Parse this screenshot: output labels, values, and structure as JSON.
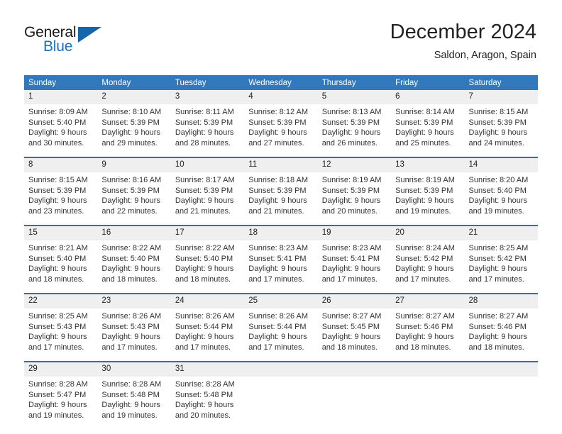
{
  "brand": {
    "name_part1": "General",
    "name_part2": "Blue",
    "triangle_icon": "triangle-icon",
    "accent_color": "#1565ad"
  },
  "header": {
    "month_title": "December 2024",
    "location": "Saldon, Aragon, Spain"
  },
  "calendar": {
    "header_color": "#3178bd",
    "daynum_background": "#efefef",
    "week_separator_color": "#2f6fab",
    "weekdays": [
      "Sunday",
      "Monday",
      "Tuesday",
      "Wednesday",
      "Thursday",
      "Friday",
      "Saturday"
    ],
    "weeks": [
      [
        {
          "day": "1",
          "sunrise": "Sunrise: 8:09 AM",
          "sunset": "Sunset: 5:40 PM",
          "daylight1": "Daylight: 9 hours",
          "daylight2": "and 30 minutes."
        },
        {
          "day": "2",
          "sunrise": "Sunrise: 8:10 AM",
          "sunset": "Sunset: 5:39 PM",
          "daylight1": "Daylight: 9 hours",
          "daylight2": "and 29 minutes."
        },
        {
          "day": "3",
          "sunrise": "Sunrise: 8:11 AM",
          "sunset": "Sunset: 5:39 PM",
          "daylight1": "Daylight: 9 hours",
          "daylight2": "and 28 minutes."
        },
        {
          "day": "4",
          "sunrise": "Sunrise: 8:12 AM",
          "sunset": "Sunset: 5:39 PM",
          "daylight1": "Daylight: 9 hours",
          "daylight2": "and 27 minutes."
        },
        {
          "day": "5",
          "sunrise": "Sunrise: 8:13 AM",
          "sunset": "Sunset: 5:39 PM",
          "daylight1": "Daylight: 9 hours",
          "daylight2": "and 26 minutes."
        },
        {
          "day": "6",
          "sunrise": "Sunrise: 8:14 AM",
          "sunset": "Sunset: 5:39 PM",
          "daylight1": "Daylight: 9 hours",
          "daylight2": "and 25 minutes."
        },
        {
          "day": "7",
          "sunrise": "Sunrise: 8:15 AM",
          "sunset": "Sunset: 5:39 PM",
          "daylight1": "Daylight: 9 hours",
          "daylight2": "and 24 minutes."
        }
      ],
      [
        {
          "day": "8",
          "sunrise": "Sunrise: 8:15 AM",
          "sunset": "Sunset: 5:39 PM",
          "daylight1": "Daylight: 9 hours",
          "daylight2": "and 23 minutes."
        },
        {
          "day": "9",
          "sunrise": "Sunrise: 8:16 AM",
          "sunset": "Sunset: 5:39 PM",
          "daylight1": "Daylight: 9 hours",
          "daylight2": "and 22 minutes."
        },
        {
          "day": "10",
          "sunrise": "Sunrise: 8:17 AM",
          "sunset": "Sunset: 5:39 PM",
          "daylight1": "Daylight: 9 hours",
          "daylight2": "and 21 minutes."
        },
        {
          "day": "11",
          "sunrise": "Sunrise: 8:18 AM",
          "sunset": "Sunset: 5:39 PM",
          "daylight1": "Daylight: 9 hours",
          "daylight2": "and 21 minutes."
        },
        {
          "day": "12",
          "sunrise": "Sunrise: 8:19 AM",
          "sunset": "Sunset: 5:39 PM",
          "daylight1": "Daylight: 9 hours",
          "daylight2": "and 20 minutes."
        },
        {
          "day": "13",
          "sunrise": "Sunrise: 8:19 AM",
          "sunset": "Sunset: 5:39 PM",
          "daylight1": "Daylight: 9 hours",
          "daylight2": "and 19 minutes."
        },
        {
          "day": "14",
          "sunrise": "Sunrise: 8:20 AM",
          "sunset": "Sunset: 5:40 PM",
          "daylight1": "Daylight: 9 hours",
          "daylight2": "and 19 minutes."
        }
      ],
      [
        {
          "day": "15",
          "sunrise": "Sunrise: 8:21 AM",
          "sunset": "Sunset: 5:40 PM",
          "daylight1": "Daylight: 9 hours",
          "daylight2": "and 18 minutes."
        },
        {
          "day": "16",
          "sunrise": "Sunrise: 8:22 AM",
          "sunset": "Sunset: 5:40 PM",
          "daylight1": "Daylight: 9 hours",
          "daylight2": "and 18 minutes."
        },
        {
          "day": "17",
          "sunrise": "Sunrise: 8:22 AM",
          "sunset": "Sunset: 5:40 PM",
          "daylight1": "Daylight: 9 hours",
          "daylight2": "and 18 minutes."
        },
        {
          "day": "18",
          "sunrise": "Sunrise: 8:23 AM",
          "sunset": "Sunset: 5:41 PM",
          "daylight1": "Daylight: 9 hours",
          "daylight2": "and 17 minutes."
        },
        {
          "day": "19",
          "sunrise": "Sunrise: 8:23 AM",
          "sunset": "Sunset: 5:41 PM",
          "daylight1": "Daylight: 9 hours",
          "daylight2": "and 17 minutes."
        },
        {
          "day": "20",
          "sunrise": "Sunrise: 8:24 AM",
          "sunset": "Sunset: 5:42 PM",
          "daylight1": "Daylight: 9 hours",
          "daylight2": "and 17 minutes."
        },
        {
          "day": "21",
          "sunrise": "Sunrise: 8:25 AM",
          "sunset": "Sunset: 5:42 PM",
          "daylight1": "Daylight: 9 hours",
          "daylight2": "and 17 minutes."
        }
      ],
      [
        {
          "day": "22",
          "sunrise": "Sunrise: 8:25 AM",
          "sunset": "Sunset: 5:43 PM",
          "daylight1": "Daylight: 9 hours",
          "daylight2": "and 17 minutes."
        },
        {
          "day": "23",
          "sunrise": "Sunrise: 8:26 AM",
          "sunset": "Sunset: 5:43 PM",
          "daylight1": "Daylight: 9 hours",
          "daylight2": "and 17 minutes."
        },
        {
          "day": "24",
          "sunrise": "Sunrise: 8:26 AM",
          "sunset": "Sunset: 5:44 PM",
          "daylight1": "Daylight: 9 hours",
          "daylight2": "and 17 minutes."
        },
        {
          "day": "25",
          "sunrise": "Sunrise: 8:26 AM",
          "sunset": "Sunset: 5:44 PM",
          "daylight1": "Daylight: 9 hours",
          "daylight2": "and 17 minutes."
        },
        {
          "day": "26",
          "sunrise": "Sunrise: 8:27 AM",
          "sunset": "Sunset: 5:45 PM",
          "daylight1": "Daylight: 9 hours",
          "daylight2": "and 18 minutes."
        },
        {
          "day": "27",
          "sunrise": "Sunrise: 8:27 AM",
          "sunset": "Sunset: 5:46 PM",
          "daylight1": "Daylight: 9 hours",
          "daylight2": "and 18 minutes."
        },
        {
          "day": "28",
          "sunrise": "Sunrise: 8:27 AM",
          "sunset": "Sunset: 5:46 PM",
          "daylight1": "Daylight: 9 hours",
          "daylight2": "and 18 minutes."
        }
      ],
      [
        {
          "day": "29",
          "sunrise": "Sunrise: 8:28 AM",
          "sunset": "Sunset: 5:47 PM",
          "daylight1": "Daylight: 9 hours",
          "daylight2": "and 19 minutes."
        },
        {
          "day": "30",
          "sunrise": "Sunrise: 8:28 AM",
          "sunset": "Sunset: 5:48 PM",
          "daylight1": "Daylight: 9 hours",
          "daylight2": "and 19 minutes."
        },
        {
          "day": "31",
          "sunrise": "Sunrise: 8:28 AM",
          "sunset": "Sunset: 5:48 PM",
          "daylight1": "Daylight: 9 hours",
          "daylight2": "and 20 minutes."
        },
        {
          "day": "",
          "sunrise": "",
          "sunset": "",
          "daylight1": "",
          "daylight2": ""
        },
        {
          "day": "",
          "sunrise": "",
          "sunset": "",
          "daylight1": "",
          "daylight2": ""
        },
        {
          "day": "",
          "sunrise": "",
          "sunset": "",
          "daylight1": "",
          "daylight2": ""
        },
        {
          "day": "",
          "sunrise": "",
          "sunset": "",
          "daylight1": "",
          "daylight2": ""
        }
      ]
    ]
  }
}
